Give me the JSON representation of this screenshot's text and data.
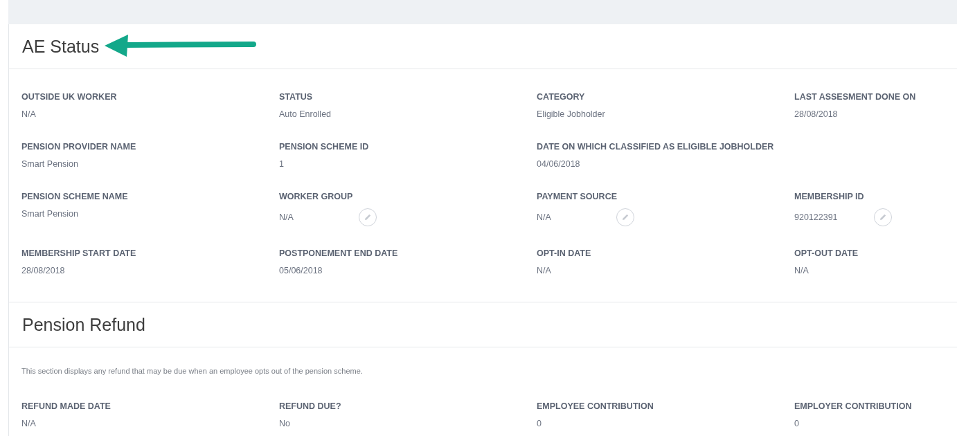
{
  "sections": [
    {
      "title": "AE Status",
      "annotation_arrow": true,
      "rows": [
        [
          {
            "label": "OUTSIDE UK WORKER",
            "value": "N/A"
          },
          {
            "label": "STATUS",
            "value": "Auto Enrolled"
          },
          {
            "label": "CATEGORY",
            "value": "Eligible Jobholder"
          },
          {
            "label": "LAST ASSESMENT DONE ON",
            "value": "28/08/2018"
          }
        ],
        [
          {
            "label": "PENSION PROVIDER NAME",
            "value": "Smart Pension"
          },
          {
            "label": "PENSION SCHEME ID",
            "value": "1"
          },
          {
            "label": "DATE ON WHICH CLASSIFIED AS ELIGIBLE JOBHOLDER",
            "value": "04/06/2018",
            "wide": true
          }
        ],
        [
          {
            "label": "PENSION SCHEME NAME",
            "value": "Smart Pension"
          },
          {
            "label": "WORKER GROUP",
            "value": "N/A",
            "editable": true
          },
          {
            "label": "PAYMENT SOURCE",
            "value": "N/A",
            "editable": true
          },
          {
            "label": "MEMBERSHIP ID",
            "value": "920122391",
            "editable": true
          }
        ],
        [
          {
            "label": "MEMBERSHIP START DATE",
            "value": "28/08/2018"
          },
          {
            "label": "POSTPONEMENT END DATE",
            "value": "05/06/2018"
          },
          {
            "label": "OPT-IN DATE",
            "value": "N/A"
          },
          {
            "label": "OPT-OUT DATE",
            "value": "N/A"
          }
        ]
      ]
    },
    {
      "title": "Pension Refund",
      "description": "This section displays any refund that may be due when an employee opts out of the pension scheme.",
      "rows": [
        [
          {
            "label": "REFUND MADE DATE",
            "value": "N/A"
          },
          {
            "label": "REFUND DUE?",
            "value": "No"
          },
          {
            "label": "EMPLOYEE CONTRIBUTION",
            "value": "0"
          },
          {
            "label": "EMPLOYER CONTRIBUTION",
            "value": "0"
          }
        ]
      ]
    }
  ]
}
